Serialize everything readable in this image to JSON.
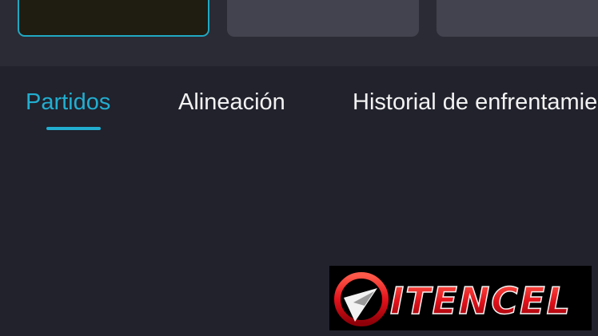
{
  "cards": {
    "selected_color": "#20a9c3",
    "card_bg": "#42434e"
  },
  "tabs": [
    {
      "label": "Partidos",
      "active": true
    },
    {
      "label": "Alineación",
      "active": false
    },
    {
      "label": "Historial de enfrentamientos",
      "active": false
    }
  ],
  "colors": {
    "background": "#21222c",
    "top_strip": "#2a2b35",
    "accent": "#22aed0",
    "tab_text": "#f2f2f2"
  },
  "watermark": {
    "text": "ITENCEL",
    "icon": "itencel-logo-icon"
  }
}
